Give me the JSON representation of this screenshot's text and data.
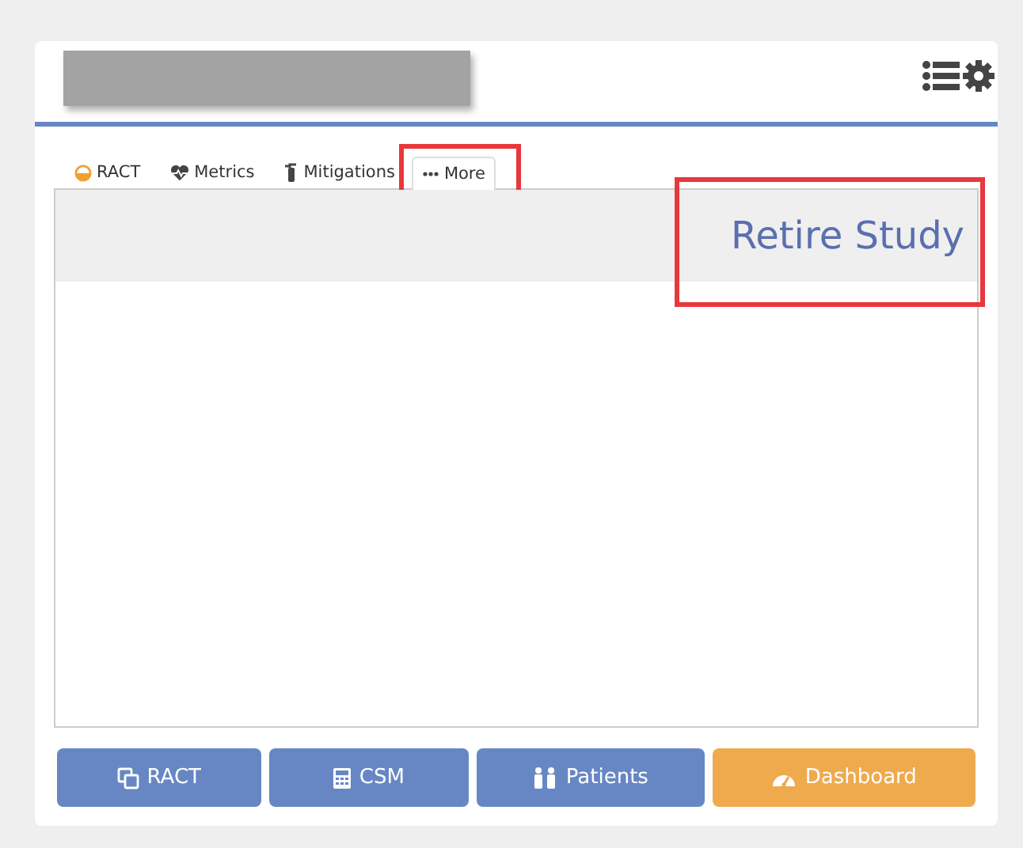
{
  "tabs": [
    {
      "label": "RACT",
      "selected": false,
      "highlighted": false
    },
    {
      "label": "Metrics",
      "selected": false,
      "highlighted": false
    },
    {
      "label": "Mitigations",
      "selected": false,
      "highlighted": false
    },
    {
      "label": "More",
      "selected": true,
      "highlighted": true
    }
  ],
  "panel": {
    "action": "Retire Study",
    "highlighted": true
  },
  "buttons": [
    {
      "label": "RACT",
      "kind": "primary"
    },
    {
      "label": "CSM",
      "kind": "primary"
    },
    {
      "label": "Patients",
      "kind": "primary"
    },
    {
      "label": "Dashboard",
      "kind": "warning"
    }
  ]
}
